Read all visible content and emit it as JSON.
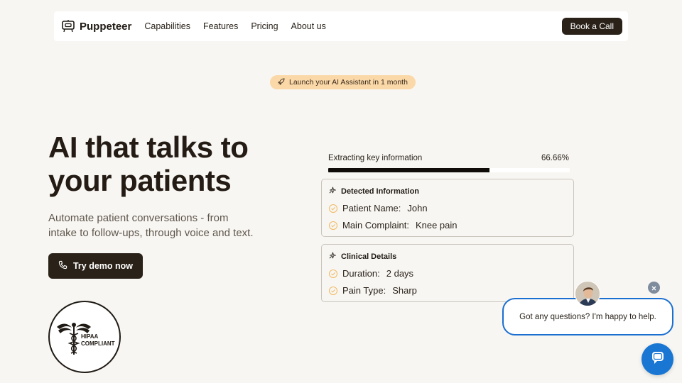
{
  "header": {
    "brand": "Puppeteer",
    "nav": [
      {
        "label": "Capabilities"
      },
      {
        "label": "Features"
      },
      {
        "label": "Pricing"
      },
      {
        "label": "About us"
      }
    ],
    "cta_label": "Book a Call"
  },
  "badge": {
    "text": "Launch your AI Assistant in 1 month",
    "icon": "rocket-icon"
  },
  "hero": {
    "title_line1": "AI that talks to",
    "title_line2": "your patients",
    "subtitle_line1": "Automate patient conversations - from",
    "subtitle_line2": "intake to follow-ups, through voice and text.",
    "cta_label": "Try demo now",
    "cta_icon": "phone-icon"
  },
  "hipaa": {
    "line1": "HIPAA",
    "line2": "COMPLIANT"
  },
  "extraction": {
    "label": "Extracting key information",
    "value": "66.66%",
    "progress_percent": 66.66,
    "cards": [
      {
        "title": "Detected Information",
        "rows": [
          {
            "key": "Patient Name:",
            "value": "John"
          },
          {
            "key": "Main Complaint:",
            "value": "Knee pain"
          }
        ]
      },
      {
        "title": "Clinical Details",
        "rows": [
          {
            "key": "Duration:",
            "value": "2 days"
          },
          {
            "key": "Pain Type:",
            "value": "Sharp"
          }
        ]
      }
    ]
  },
  "chat": {
    "message": "Got any questions? I'm happy to help.",
    "accent": "#1976d2"
  },
  "colors": {
    "background": "#f8f6f2",
    "dark_button": "#2a2118",
    "badge": "#fbd8a8",
    "check": "#f0b961"
  }
}
